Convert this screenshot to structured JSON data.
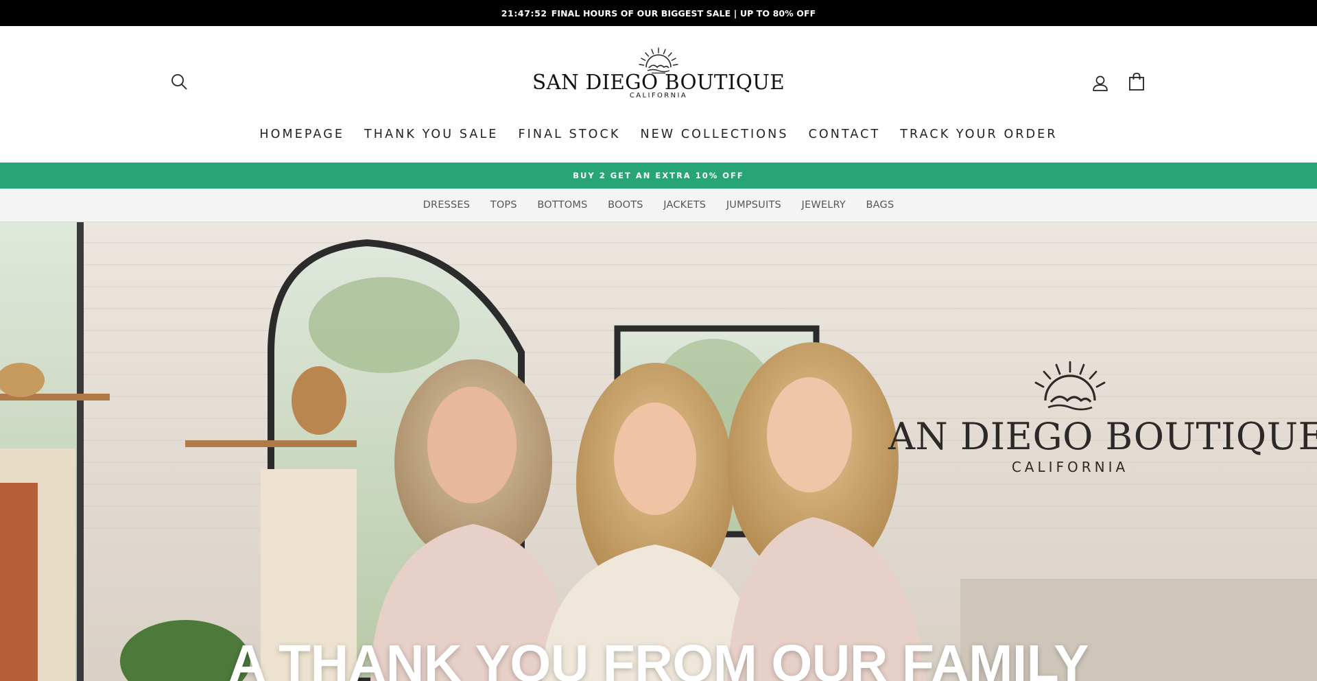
{
  "announcement": {
    "timer": "21:47:52",
    "text": "FINAL HOURS OF OUR BIGGEST SALE | UP TO 80% OFF"
  },
  "header": {
    "logo": {
      "brand": "SAN DIEGO BOUTIQUE",
      "subtitle": "CALIFORNIA"
    },
    "icons": {
      "search": "search-icon",
      "account": "user-icon",
      "cart": "shopping-bag-icon"
    }
  },
  "main_nav": {
    "items": [
      "HOMEPAGE",
      "THANK YOU SALE",
      "FINAL STOCK",
      "NEW COLLECTIONS",
      "CONTACT",
      "TRACK YOUR ORDER"
    ]
  },
  "promo_bar": {
    "text": "BUY 2 GET AN EXTRA 10% OFF",
    "color": "#27a577"
  },
  "category_nav": {
    "items": [
      "DRESSES",
      "TOPS",
      "BOTTOMS",
      "BOOTS",
      "JACKETS",
      "JUMPSUITS",
      "JEWELRY",
      "BAGS"
    ]
  },
  "hero": {
    "title": "A THANK YOU FROM OUR FAMILY",
    "wall_sign": {
      "brand": "AN DIEGO BOUTIQUE",
      "subtitle": "CALIFORNIA"
    }
  }
}
